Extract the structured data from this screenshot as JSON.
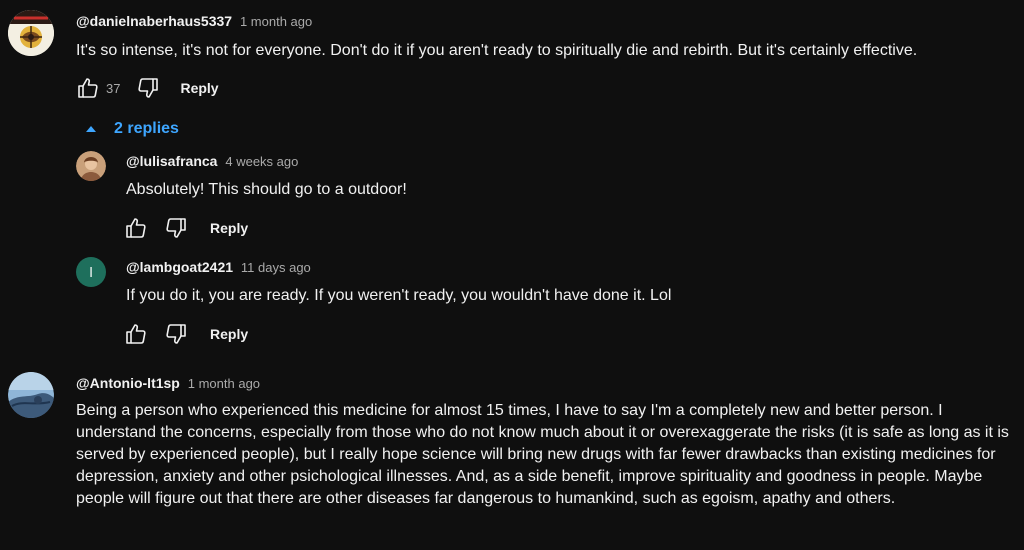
{
  "comments": [
    {
      "author": "@danielnaberhaus5337",
      "time": "1 month ago",
      "text": "It's so intense, it's not for everyone. Don't do it if you aren't ready to spiritually die and rebirth. But it's certainly effective.",
      "likes": "37",
      "reply_label": "Reply",
      "replies_toggle": "2 replies",
      "replies": [
        {
          "author": "@lulisafranca",
          "time": "4 weeks ago",
          "text": "Absolutely! This should go to a outdoor!",
          "reply_label": "Reply"
        },
        {
          "author": "@lambgoat2421",
          "time": "11 days ago",
          "avatar_letter": "l",
          "avatar_color": "#1e6f5c",
          "text": "If you do it, you are ready. If you weren't ready, you wouldn't have done it. Lol",
          "reply_label": "Reply"
        }
      ]
    },
    {
      "author": "@Antonio-lt1sp",
      "time": "1 month ago",
      "text": "Being a person who experienced this medicine for almost 15 times, I have to say I'm a completely new and better person. I understand the concerns, especially from those who do not know much about it or overexaggerate the risks (it is safe as long as it is served by experienced people), but I really hope science will bring new drugs with far fewer drawbacks than existing medicines for depression, anxiety and other psichological illnesses. And, as a side benefit, improve spirituality and goodness in people. Maybe people will figure out that there are other diseases far dangerous to humankind, such as egoism, apathy and others."
    }
  ],
  "colors": {
    "background": "#0f0f0f",
    "link_blue": "#3ea6ff",
    "muted": "#aaaaaa"
  }
}
